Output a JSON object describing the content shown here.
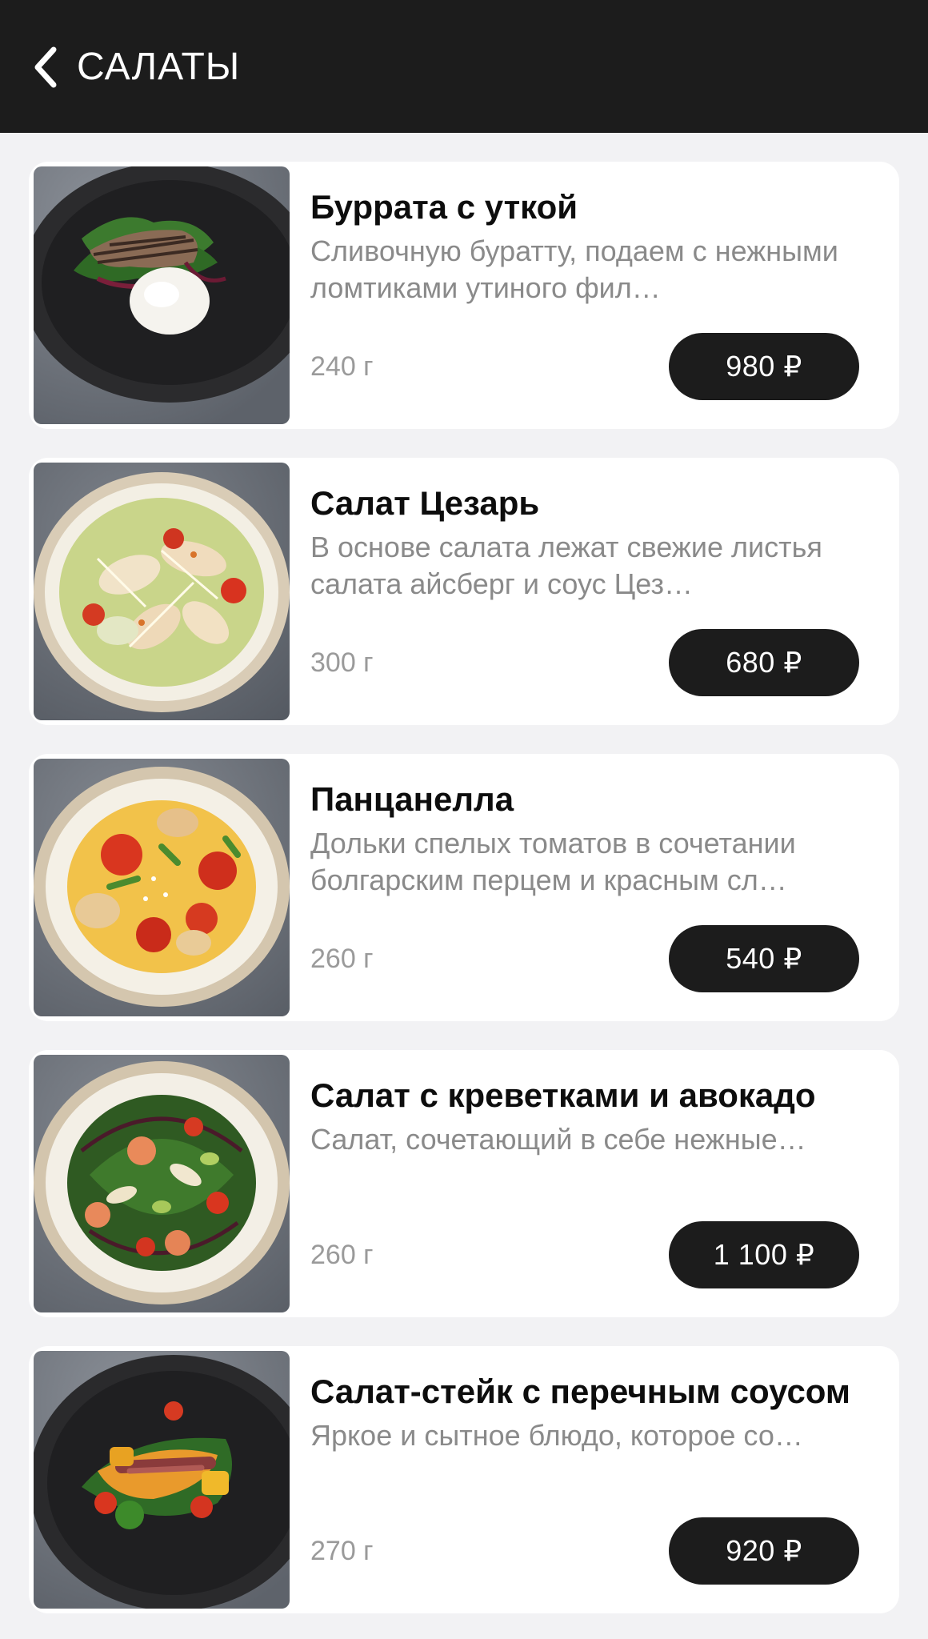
{
  "header": {
    "title": "САЛАТЫ",
    "back_icon": "chevron-left-icon"
  },
  "colors": {
    "topbar": "#1c1c1c",
    "background": "#f2f2f4",
    "card": "#ffffff",
    "price_button": "#1c1c1c",
    "description_text": "#8a8a8a"
  },
  "items": [
    {
      "name": "Буррата с уткой",
      "description": "Сливочную буратту, подаем с нежными ломтиками утиного фил…",
      "weight": "240 г",
      "price": "980 ₽",
      "image": "dark-plate-duck-burrata"
    },
    {
      "name": "Салат Цезарь",
      "description": "В основе салата лежат свежие листья салата айсберг и соус Цез…",
      "weight": "300 г",
      "price": "680 ₽",
      "image": "bowl-caesar-salad"
    },
    {
      "name": "Панцанелла",
      "description": "Дольки спелых томатов в сочетании болгарским перцем и красным сл…",
      "weight": "260 г",
      "price": "540 ₽",
      "image": "bowl-panzanella"
    },
    {
      "name": "Салат с креветками и авокадо",
      "description": "Салат, сочетающий в себе нежные…",
      "weight": "260 г",
      "price": "1 100 ₽",
      "image": "bowl-shrimp-avocado"
    },
    {
      "name": "Салат-стейк с перечным соусом",
      "description": "Яркое и сытное блюдо, которое со…",
      "weight": "270 г",
      "price": "920 ₽",
      "image": "dark-plate-steak-salad"
    }
  ]
}
